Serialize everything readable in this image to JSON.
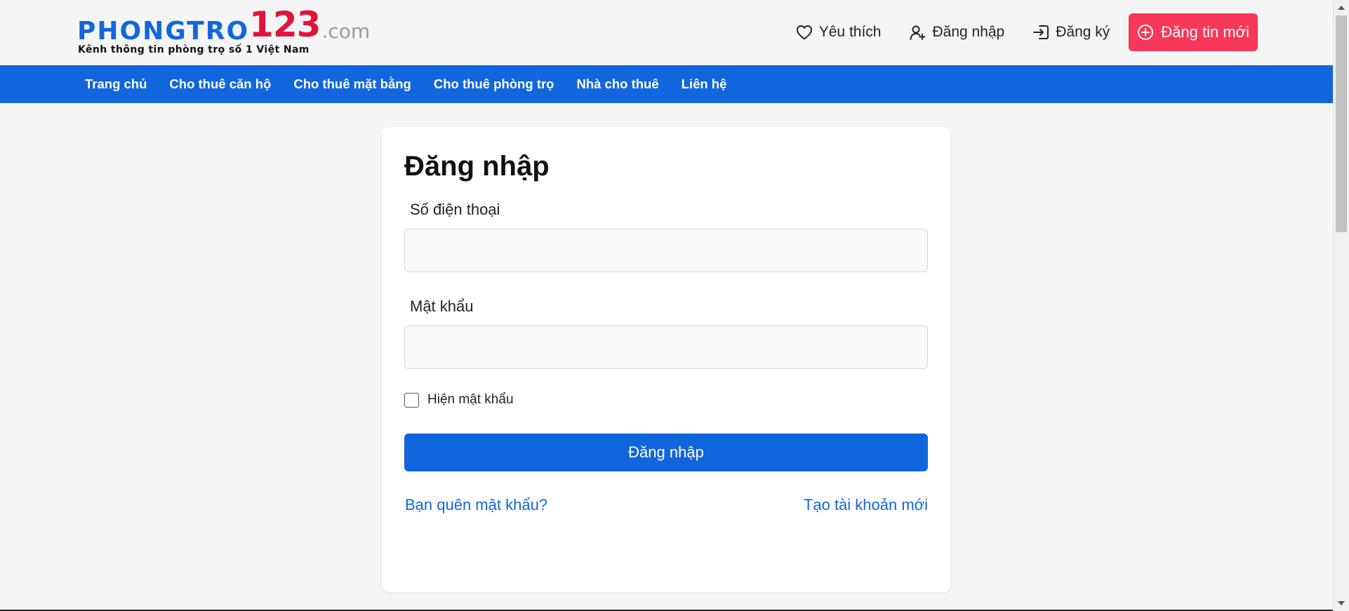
{
  "header": {
    "logo": {
      "word": "PHONGTRO",
      "number": "123",
      "suffix": ".com",
      "tagline": "Kênh thông tin phòng trọ số 1 Việt Nam"
    },
    "actions": {
      "favorite_label": "Yêu thích",
      "login_label": "Đăng nhập",
      "register_label": "Đăng ký",
      "post_label": "Đăng tin mới"
    }
  },
  "nav": {
    "items": [
      {
        "label": "Trang chủ"
      },
      {
        "label": "Cho thuê căn hộ"
      },
      {
        "label": "Cho thuê mặt bằng"
      },
      {
        "label": "Cho thuê phòng trọ"
      },
      {
        "label": "Nhà cho thuê"
      },
      {
        "label": "Liên hệ"
      }
    ]
  },
  "login": {
    "title": "Đăng nhập",
    "phone_label": "Số điện thoại",
    "phone_value": "",
    "password_label": "Mật khẩu",
    "password_value": "",
    "show_password_label": "Hiện mật khẩu",
    "submit_label": "Đăng nhập",
    "forgot_link": "Bạn quên mật khẩu?",
    "create_link": "Tạo tài khoản mới"
  },
  "colors": {
    "brand_blue": "#1266dd",
    "brand_red": "#e0153a",
    "post_button": "#f73859",
    "background": "#f5f5f5"
  },
  "icons": {
    "favorite": "heart-icon",
    "login": "user-icon",
    "register": "sign-in-icon",
    "post": "plus-circle-icon"
  }
}
